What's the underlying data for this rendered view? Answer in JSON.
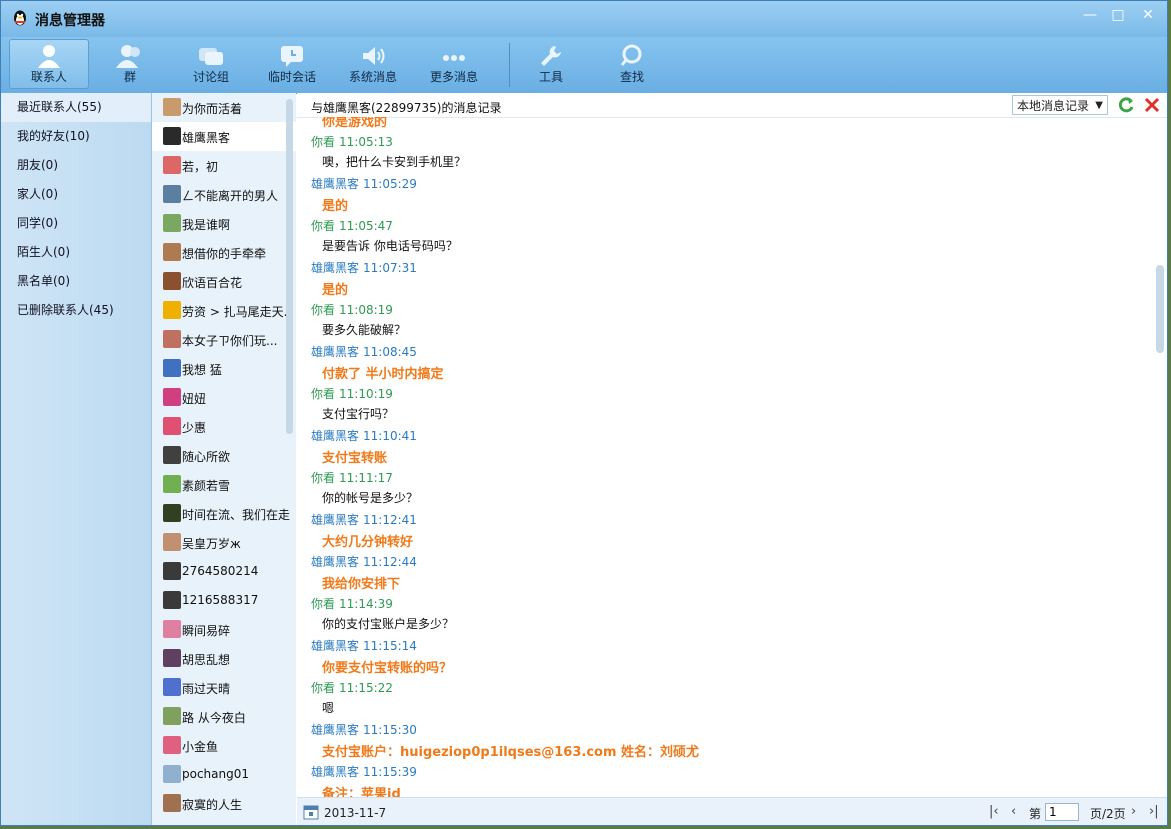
{
  "window": {
    "title": "消息管理器"
  },
  "toolbar": {
    "items": [
      {
        "label": "联系人"
      },
      {
        "label": "群"
      },
      {
        "label": "讨论组"
      },
      {
        "label": "临时会话"
      },
      {
        "label": "系统消息"
      },
      {
        "label": "更多消息"
      },
      {
        "label": "工具"
      },
      {
        "label": "查找"
      }
    ]
  },
  "categories": [
    {
      "label": "最近联系人(55)"
    },
    {
      "label": "我的好友(10)"
    },
    {
      "label": "朋友(0)"
    },
    {
      "label": "家人(0)"
    },
    {
      "label": "同学(0)"
    },
    {
      "label": "陌生人(0)"
    },
    {
      "label": "黑名单(0)"
    },
    {
      "label": "已删除联系人(45)"
    }
  ],
  "contacts": [
    {
      "name": "为你而活着"
    },
    {
      "name": "雄鹰黑客"
    },
    {
      "name": "若，初"
    },
    {
      "name": "ㄥ不能离开的男人"
    },
    {
      "name": "我是谁啊"
    },
    {
      "name": "想借你的手牵牵"
    },
    {
      "name": "欣语百合花"
    },
    {
      "name": "劳资 > 扎马尾走天..."
    },
    {
      "name": " 本女子ㄗ你们玩..."
    },
    {
      "name": "我想 猛"
    },
    {
      "name": "妞妞"
    },
    {
      "name": "少惠"
    },
    {
      "name": "随心所欲"
    },
    {
      "name": "素颜若雪"
    },
    {
      "name": "时间在流、我们在走"
    },
    {
      "name": "  吴皇万岁ж"
    },
    {
      "name": "2764580214"
    },
    {
      "name": "1216588317"
    },
    {
      "name": "瞬间易碎"
    },
    {
      "name": "胡思乱想"
    },
    {
      "name": "雨过天晴"
    },
    {
      "name": "路  从今夜白"
    },
    {
      "name": "小金鱼"
    },
    {
      "name": "pochang01"
    },
    {
      "name": "寂寞的人生"
    }
  ],
  "chat": {
    "title": "与雄鹰黑客(22899735)的消息记录",
    "source_select": "本地消息记录",
    "messages": [
      {
        "sender": "",
        "time": "",
        "text": "你是游戏的",
        "bold": true
      },
      {
        "sender": "你看",
        "time": "11:05:13",
        "text": "噢，把什么卡安到手机里？",
        "bold": false
      },
      {
        "sender": "雄鹰黑客",
        "time": "11:05:29",
        "text": "是的",
        "bold": true
      },
      {
        "sender": "你看",
        "time": "11:05:47",
        "text": "是要告诉 你电话号码吗？",
        "bold": false
      },
      {
        "sender": "雄鹰黑客",
        "time": "11:07:31",
        "text": "是的",
        "bold": true
      },
      {
        "sender": "你看",
        "time": "11:08:19",
        "text": "要多久能破解？",
        "bold": false
      },
      {
        "sender": "雄鹰黑客",
        "time": "11:08:45",
        "text": "付款了  半小时内搞定",
        "bold": true
      },
      {
        "sender": "你看",
        "time": "11:10:19",
        "text": "支付宝行吗？",
        "bold": false
      },
      {
        "sender": "雄鹰黑客",
        "time": "11:10:41",
        "text": "支付宝转账",
        "bold": true
      },
      {
        "sender": "你看",
        "time": "11:11:17",
        "text": "你的帐号是多少？",
        "bold": false
      },
      {
        "sender": "雄鹰黑客",
        "time": "11:12:41",
        "text": "大约几分钟转好",
        "bold": true
      },
      {
        "sender": "雄鹰黑客",
        "time": "11:12:44",
        "text": "我给你安排下",
        "bold": true
      },
      {
        "sender": "你看",
        "time": "11:14:39",
        "text": "你的支付宝账户是多少？",
        "bold": false
      },
      {
        "sender": "雄鹰黑客",
        "time": "11:15:14",
        "text": "你要支付宝转账的吗？",
        "bold": true
      },
      {
        "sender": "你看",
        "time": "11:15:22",
        "text": "嗯",
        "bold": false
      },
      {
        "sender": "雄鹰黑客",
        "time": "11:15:30",
        "text": "支付宝账户：huigeziop0p1ilqses@163.com 姓名：刘硕尤",
        "bold": true
      },
      {
        "sender": "雄鹰黑客",
        "time": "11:15:39",
        "text": "备注：苹果id",
        "bold": true
      }
    ],
    "footer": {
      "date": "2013-11-7",
      "page_prefix": "第",
      "page_value": "1",
      "page_suffix": "页/2页"
    }
  }
}
